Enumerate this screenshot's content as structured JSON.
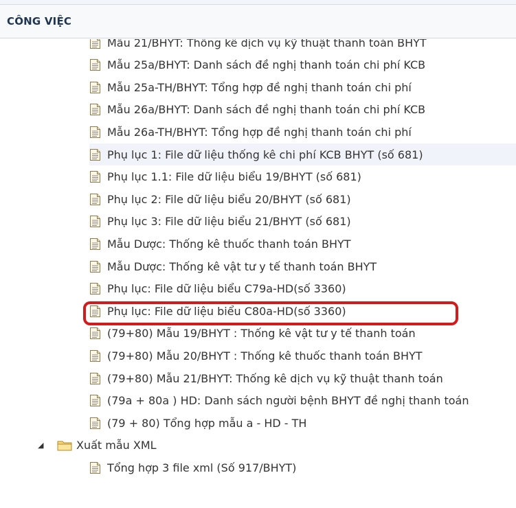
{
  "header": {
    "title": "CÔNG VIỆC"
  },
  "items": [
    {
      "label": "Mẫu 21/BHYT: Thống kê dịch vụ kỹ thuật thanh toán BHYT"
    },
    {
      "label": "Mẫu 25a/BHYT: Danh sách đề nghị thanh toán chi phí KCB"
    },
    {
      "label": "Mẫu 25a-TH/BHYT: Tổng hợp đề nghị thanh toán chi phí"
    },
    {
      "label": "Mẫu 26a/BHYT: Danh sách đề nghị thanh toán chi phí KCB"
    },
    {
      "label": "Mẫu 26a-TH/BHYT: Tổng hợp đề nghị thanh toán chi phí"
    },
    {
      "label": "Phụ lục 1: File dữ liệu thống kê chi phí KCB BHYT (số 681)"
    },
    {
      "label": "Phụ lục 1.1: File dữ liệu biểu 19/BHYT (số 681)"
    },
    {
      "label": "Phụ lục 2: File dữ liệu biểu 20/BHYT (số 681)"
    },
    {
      "label": "Phụ lục 3: File dữ liệu biểu 21/BHYT (số 681)"
    },
    {
      "label": "Mẫu Dược: Thống kê thuốc thanh toán BHYT"
    },
    {
      "label": "Mẫu Dược: Thống kê vật tư y tế thanh toán BHYT"
    },
    {
      "label": "Phụ lục: File dữ liệu biểu C79a-HD(số 3360)"
    },
    {
      "label": "Phụ lục: File dữ liệu biểu C80a-HD(số 3360)"
    },
    {
      "label": "(79+80) Mẫu 19/BHYT : Thống kê vật tư y tế thanh toán"
    },
    {
      "label": "(79+80) Mẫu 20/BHYT : Thống kê thuốc thanh toán BHYT"
    },
    {
      "label": "(79+80) Mẫu 21/BHYT: Thống kê dịch vụ kỹ thuật thanh toán"
    },
    {
      "label": "(79a + 80a ) HD: Danh sách người bệnh BHYT đề nghị thanh toán"
    },
    {
      "label": "(79 + 80) Tổng hợp mẫu a - HD - TH"
    }
  ],
  "folder": {
    "label": "Xuất mẫu XML",
    "expander": "◢",
    "icon": "folder-icon"
  },
  "sub_items": [
    {
      "label": "Tổng hợp 3 file xml (Số 917/BHYT)"
    }
  ],
  "selected_index": 5,
  "highlight_color": "#d01c1c"
}
